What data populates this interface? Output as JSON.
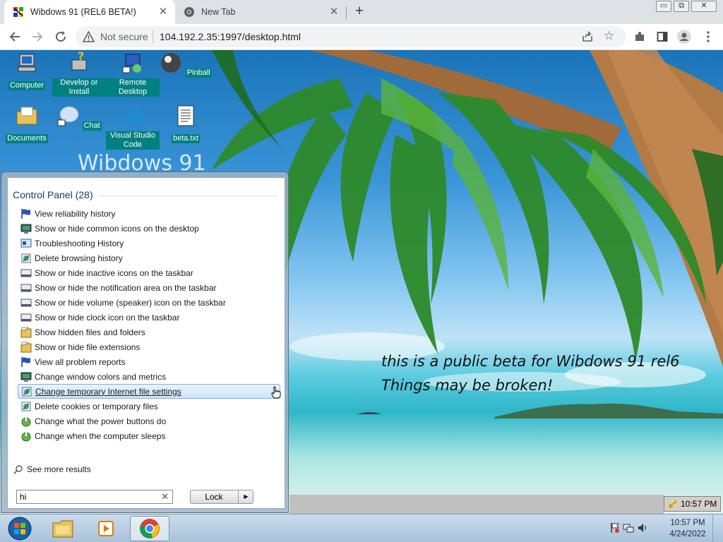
{
  "browser": {
    "tabs": [
      {
        "title": "Wibdows 91 (REL6 BETA!)",
        "active": true
      },
      {
        "title": "New Tab",
        "active": false
      }
    ],
    "security_label": "Not secure",
    "url": "104.192.2.35:1997/desktop.html"
  },
  "desktop": {
    "icons": [
      {
        "label": "Computer",
        "icon": "computer-icon"
      },
      {
        "label": "Develop or Install",
        "icon": "develop-install-icon"
      },
      {
        "label": "Remote Desktop",
        "icon": "remote-desktop-icon"
      },
      {
        "label": "Pinball",
        "icon": "pinball-icon"
      },
      {
        "label": "Documents",
        "icon": "documents-icon"
      },
      {
        "label": "Chat",
        "icon": "chat-icon"
      },
      {
        "label": "Visual Studio Code",
        "icon": "vscode-icon"
      },
      {
        "label": "beta.txt",
        "icon": "text-file-icon"
      }
    ],
    "beta_message_line1": "this is a public beta for Wibdows 91 rel6",
    "beta_message_line2": "Things may be broken!",
    "tray_time": "10:57 PM",
    "background_text": "Wibdows 91"
  },
  "start_menu": {
    "heading": "Control Panel (28)",
    "items": [
      {
        "label": "View reliability history",
        "icon": "flag-icon"
      },
      {
        "label": "Show or hide common icons on the desktop",
        "icon": "monitor-icon"
      },
      {
        "label": "Troubleshooting History",
        "icon": "troubleshoot-icon"
      },
      {
        "label": "Delete browsing history",
        "icon": "internet-options-icon"
      },
      {
        "label": "Show or hide inactive icons on the taskbar",
        "icon": "taskbar-icon"
      },
      {
        "label": "Show or hide the notification area on the taskbar",
        "icon": "taskbar-icon"
      },
      {
        "label": "Show or hide volume (speaker) icon on the taskbar",
        "icon": "taskbar-icon"
      },
      {
        "label": "Show or hide clock icon on the taskbar",
        "icon": "taskbar-icon"
      },
      {
        "label": "Show hidden files and folders",
        "icon": "folder-options-icon"
      },
      {
        "label": "Show or hide file extensions",
        "icon": "folder-options-icon"
      },
      {
        "label": "View all problem reports",
        "icon": "flag-icon"
      },
      {
        "label": "Change window colors and metrics",
        "icon": "monitor-icon"
      },
      {
        "label": "Change temporary Internet file settings",
        "icon": "internet-options-icon",
        "highlighted": true
      },
      {
        "label": "Delete cookies or temporary files",
        "icon": "internet-options-icon"
      },
      {
        "label": "Change what the power buttons do",
        "icon": "power-options-icon"
      },
      {
        "label": "Change when the computer sleeps",
        "icon": "power-options-icon"
      }
    ],
    "see_more": "See more results",
    "search_value": "hi",
    "lock_label": "Lock"
  },
  "taskbar": {
    "pinned": [
      "start-orb-icon",
      "explorer-icon",
      "media-player-icon",
      "chrome-icon"
    ],
    "clock_time": "10:57 PM",
    "clock_date": "4/24/2022"
  },
  "colors": {
    "icon_label_bg": "#008080",
    "highlight_border": "#84acdd",
    "browser_chrome": "#dee1e6"
  }
}
